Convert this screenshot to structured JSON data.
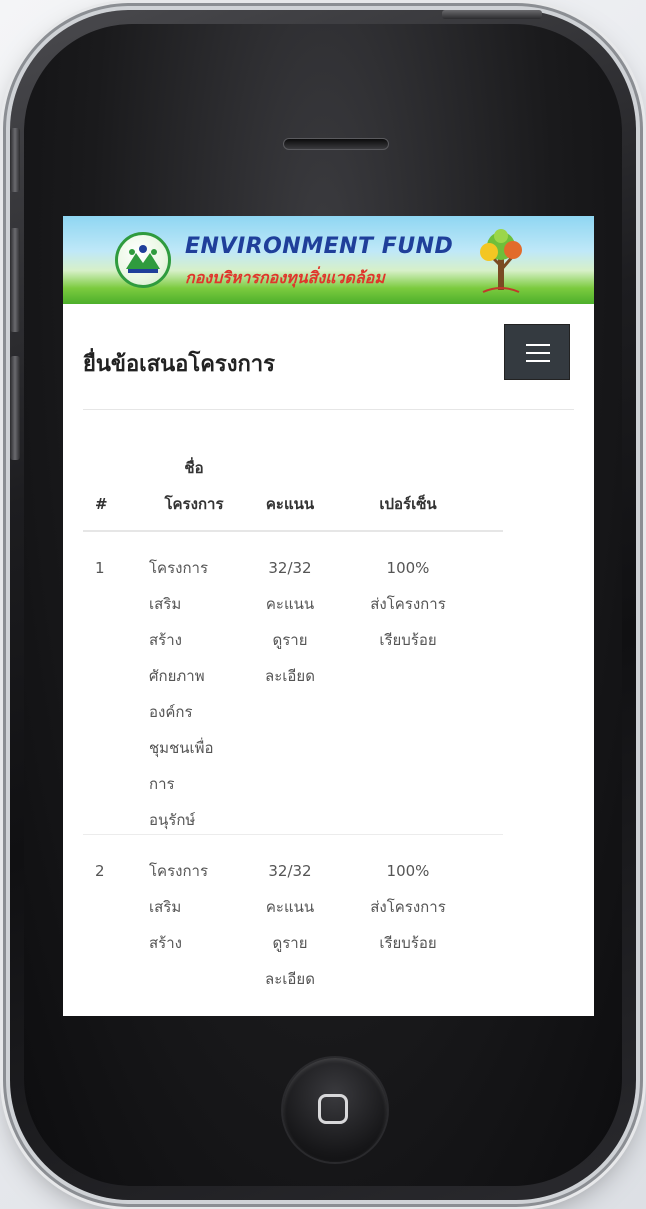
{
  "banner": {
    "title": "ENVIRONMENT FUND",
    "subtitle": "กองบริหารกองทุนสิ่งแวดล้อม"
  },
  "page": {
    "title": "ยื่นข้อเสนอโครงการ"
  },
  "table": {
    "headers": {
      "num": "#",
      "name_line1": "ชื่อ",
      "name_line2": "โครงการ",
      "score": "คะแนน",
      "percent": "เปอร์เซ็น"
    },
    "rows": [
      {
        "num": "1",
        "name_lines": [
          "โครงการ",
          "เสริม",
          "สร้าง",
          "ศักยภาพ",
          "องค์กร",
          "ชุมชนเพื่อ",
          "การ",
          "อนุรักษ์"
        ],
        "score": "32/32",
        "score_unit": "คะแนน",
        "detail_line1": "ดูราย",
        "detail_line2": "ละเอียด",
        "percent": "100%",
        "status_line1": "ส่งโครงการ",
        "status_line2": "เรียบร้อย"
      },
      {
        "num": "2",
        "name_lines": [
          "โครงการ",
          "เสริม",
          "สร้าง"
        ],
        "score": "32/32",
        "score_unit": "คะแนน",
        "detail_line1": "ดูราย",
        "detail_line2": "ละเอียด",
        "percent": "100%",
        "status_line1": "ส่งโครงการ",
        "status_line2": "เรียบร้อย"
      }
    ]
  },
  "icons": {
    "menu": "hamburger-icon",
    "logo": "environment-fund-logo",
    "tree": "tree-icon",
    "home": "home-button-icon"
  },
  "colors": {
    "title_blue": "#1f3f9a",
    "subtitle_red": "#e0352b",
    "menu_button": "#343a40",
    "banner_green": "#4caf2b"
  }
}
